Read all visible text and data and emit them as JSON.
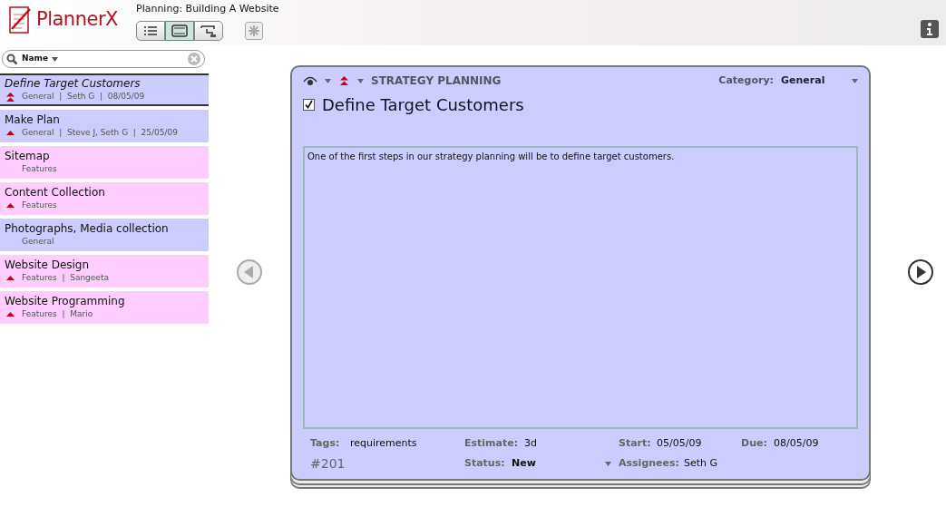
{
  "app": {
    "logo": "PlannerX",
    "project_title": "Planning: Building A Website",
    "view_buttons": [
      {
        "selected": false
      },
      {
        "selected": true
      },
      {
        "selected": false
      }
    ]
  },
  "search": {
    "scope": "Name"
  },
  "tasks": [
    {
      "title": "Define Target Customers",
      "meta": "General  |  Seth G  |  08/05/09",
      "priority": {
        "kind": "high"
      },
      "color": "#ccccff",
      "selected": true
    },
    {
      "title": "Make Plan",
      "meta": "General  |  Steve J, Seth G  |  25/05/09",
      "priority": {
        "kind": "medium"
      },
      "color": "#ccccff",
      "selected": false
    },
    {
      "title": "Sitemap",
      "meta": "Features",
      "priority": {
        "kind": "none"
      },
      "color": "#ffccff",
      "selected": false
    },
    {
      "title": "Content Collection",
      "meta": "Features",
      "priority": {
        "kind": "medium"
      },
      "color": "#ffccff",
      "selected": false
    },
    {
      "title": "Photographs, Media collection",
      "meta": "General",
      "priority": {
        "kind": "none"
      },
      "color": "#ccccff",
      "selected": false
    },
    {
      "title": "Website Design",
      "meta": "Features  |  Sangeeta",
      "priority": {
        "kind": "medium"
      },
      "color": "#ffccff",
      "selected": false
    },
    {
      "title": "Website Programming",
      "meta": "Features  |  Mario",
      "priority": {
        "kind": "medium"
      },
      "color": "#ffccff",
      "selected": false
    }
  ],
  "detail": {
    "priority": {
      "kind": "high"
    },
    "section": "STRATEGY PLANNING",
    "category_label": "Category:",
    "category": "General",
    "done": true,
    "title": "Define Target Customers",
    "description": "One of the first steps in our strategy planning will be to define target customers.",
    "fields_row1": [
      {
        "label": "Tags:",
        "value": "requirements"
      },
      {
        "label": "Estimate:",
        "value": "3d"
      },
      {
        "label": "Start:",
        "value": "05/05/09"
      },
      {
        "label": "Due:",
        "value": "08/05/09"
      }
    ],
    "number": "#201",
    "fields_row2": [
      {
        "label": "Status:",
        "value": "New",
        "kind": "dropdown"
      },
      {
        "label": "Assignees:",
        "value": "Seth G",
        "kind": "text"
      }
    ]
  }
}
